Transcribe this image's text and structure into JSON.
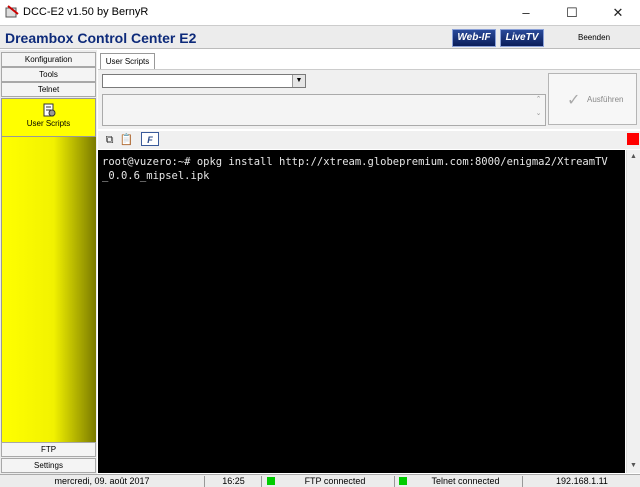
{
  "window": {
    "title": "DCC-E2 v1.50 by BernyR",
    "minimize_glyph": "–",
    "maximize_glyph": "☐",
    "close_glyph": "✕"
  },
  "header": {
    "app_title": "Dreambox Control Center E2",
    "logo_webif": "Web-IF",
    "logo_livetv": "LiveTV",
    "exit_label": "Beenden"
  },
  "sidebar": {
    "top_items": [
      "Konfiguration",
      "Tools",
      "Telnet"
    ],
    "active_item": "User Scripts",
    "bottom_items": [
      "FTP",
      "Settings"
    ]
  },
  "main": {
    "tab_label": "User Scripts",
    "combo_value": "",
    "execute_label": "Ausführen",
    "toolbar": {
      "copy_icon": "copy-icon",
      "paste_icon": "paste-icon",
      "font_icon": "font-icon"
    },
    "terminal_text": "root@vuzero:~# opkg install http://xtream.globepremium.com:8000/enigma2/XtreamTV\n_0.0.6_mipsel.ipk"
  },
  "statusbar": {
    "date": "mercredi, 09. août 2017",
    "time": "16:25",
    "ftp_status": "FTP connected",
    "telnet_status": "Telnet connected",
    "ip": "192.168.1.11"
  },
  "colors": {
    "active_nav": "#ffff00",
    "title_blue": "#0d2a7a",
    "connected": "#00cc00",
    "indicator": "#ff0000"
  }
}
